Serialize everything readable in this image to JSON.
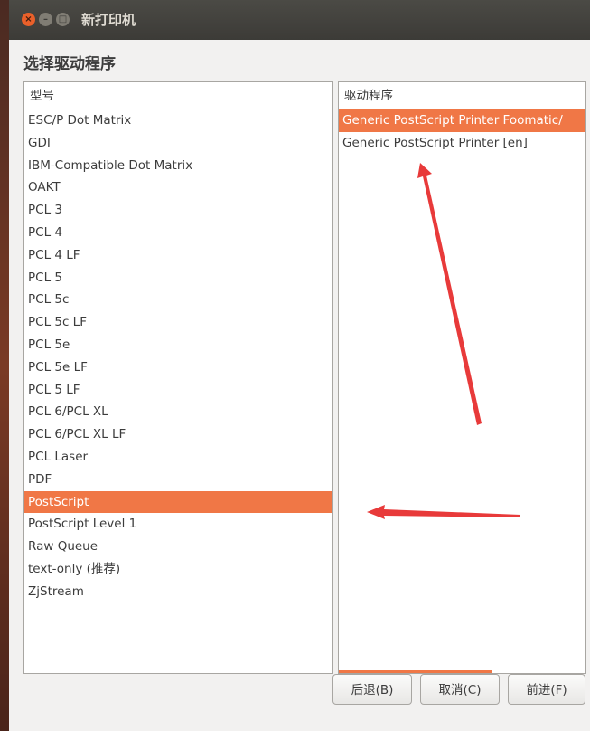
{
  "window": {
    "title": "新打印机",
    "controls": {
      "close": "×",
      "minimize": "–",
      "maximize": "□"
    }
  },
  "heading": "选择驱动程序",
  "models": {
    "header": "型号",
    "items": [
      "ESC/P Dot Matrix",
      "GDI",
      "IBM-Compatible Dot Matrix",
      "OAKT",
      "PCL 3",
      "PCL 4",
      "PCL 4 LF",
      "PCL 5",
      "PCL 5c",
      "PCL 5c LF",
      "PCL 5e",
      "PCL 5e LF",
      "PCL 5 LF",
      "PCL 6/PCL XL",
      "PCL 6/PCL XL LF",
      "PCL Laser",
      "PDF",
      "PostScript",
      "PostScript Level 1",
      "Raw Queue",
      "text-only (推荐)",
      "ZjStream"
    ],
    "selected_index": 17
  },
  "drivers": {
    "header": "驱动程序",
    "items": [
      "Generic PostScript Printer Foomatic/",
      "Generic PostScript Printer [en]"
    ],
    "selected_index": 0
  },
  "buttons": {
    "back": "后退(B)",
    "cancel": "取消(C)",
    "forward": "前进(F)"
  },
  "colors": {
    "selection": "#f07746",
    "annotation_arrow": "#e83a3a",
    "titlebar": "#3c3b37"
  }
}
